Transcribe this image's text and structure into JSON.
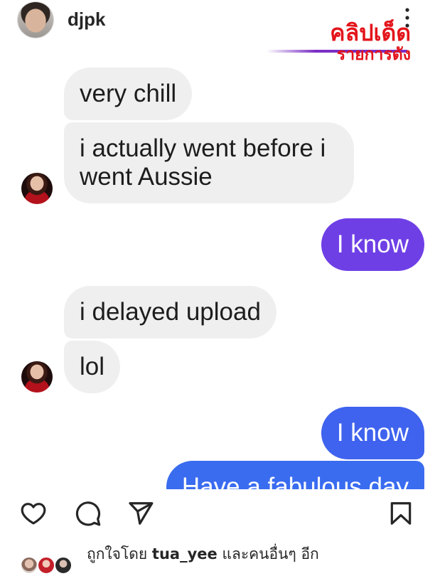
{
  "header": {
    "username": "djpk",
    "avatar_icon": "profile-avatar",
    "more_icon": "more-vertical-icon"
  },
  "watermark": {
    "title": "คลิปเด็ด",
    "subtitle": "รายการดัง",
    "text_color": "#E3151B",
    "line_color": "#7B2FC4"
  },
  "conversation": {
    "messages": [
      {
        "text": "very chill"
      },
      {
        "text": "i actually went before i went Aussie"
      },
      {
        "text": "I know"
      },
      {
        "text": "i delayed upload"
      },
      {
        "text": "lol"
      },
      {
        "text": "I know"
      },
      {
        "text": "Have a fabulous day"
      }
    ],
    "received_bubble_color": "#EFEFEF",
    "sent_bubble_colors": [
      "#6F3FE6",
      "#3F63EE",
      "#3A6CF0"
    ],
    "sender_avatar_icon": "sender-avatar"
  },
  "actions": {
    "like_icon": "heart-icon",
    "comment_icon": "comment-icon",
    "share_icon": "send-icon",
    "save_icon": "bookmark-icon"
  },
  "likes": {
    "prefix": "ถูกใจโดย",
    "user": "tua_yee",
    "suffix": "และคนอื่นๆ อีก"
  }
}
